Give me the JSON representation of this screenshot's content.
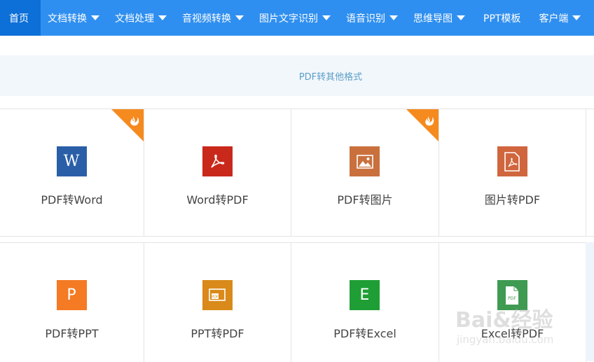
{
  "nav": {
    "items": [
      {
        "label": "首页",
        "active": true,
        "dropdown": false
      },
      {
        "label": "文档转换",
        "active": false,
        "dropdown": true
      },
      {
        "label": "文档处理",
        "active": false,
        "dropdown": true
      },
      {
        "label": "音视频转换",
        "active": false,
        "dropdown": true
      },
      {
        "label": "图片文字识别",
        "active": false,
        "dropdown": true
      },
      {
        "label": "语音识别",
        "active": false,
        "dropdown": true
      },
      {
        "label": "思维导图",
        "active": false,
        "dropdown": true
      },
      {
        "label": "PPT模板",
        "active": false,
        "dropdown": false
      },
      {
        "label": "客户端",
        "active": false,
        "dropdown": true
      }
    ]
  },
  "section": {
    "title": "PDF转其他格式"
  },
  "tools": [
    {
      "label": "PDF转Word",
      "icon": "word-icon",
      "icon_text": "W",
      "color": "#2a5fa8",
      "hot": true
    },
    {
      "label": "Word转PDF",
      "icon": "pdf-icon",
      "icon_text": "",
      "color": "#c9291b",
      "hot": false
    },
    {
      "label": "PDF转图片",
      "icon": "image-icon",
      "icon_text": "",
      "color": "#c9703d",
      "hot": true
    },
    {
      "label": "图片转PDF",
      "icon": "pdf-doc-icon",
      "icon_text": "",
      "color": "#d0663e",
      "hot": false
    },
    {
      "label": "PDF转PPT",
      "icon": "ppt-icon",
      "icon_text": "P",
      "color": "#f47a24",
      "hot": false
    },
    {
      "label": "PPT转PDF",
      "icon": "ppt-pdf-icon",
      "icon_text": "",
      "color": "#d98a1a",
      "hot": false
    },
    {
      "label": "PDF转Excel",
      "icon": "excel-icon",
      "icon_text": "E",
      "color": "#1f9e36",
      "hot": false
    },
    {
      "label": "Excel转PDF",
      "icon": "excel-pdf-icon",
      "icon_text": "",
      "color": "#3f9a52",
      "hot": false
    }
  ],
  "watermark": {
    "line1": "Bai&经验",
    "line2": "jingyan.baidu.com"
  },
  "colors": {
    "nav": "#2f8ff0",
    "nav_active": "#0d6fd8",
    "hot_badge": "#f58a1f"
  }
}
